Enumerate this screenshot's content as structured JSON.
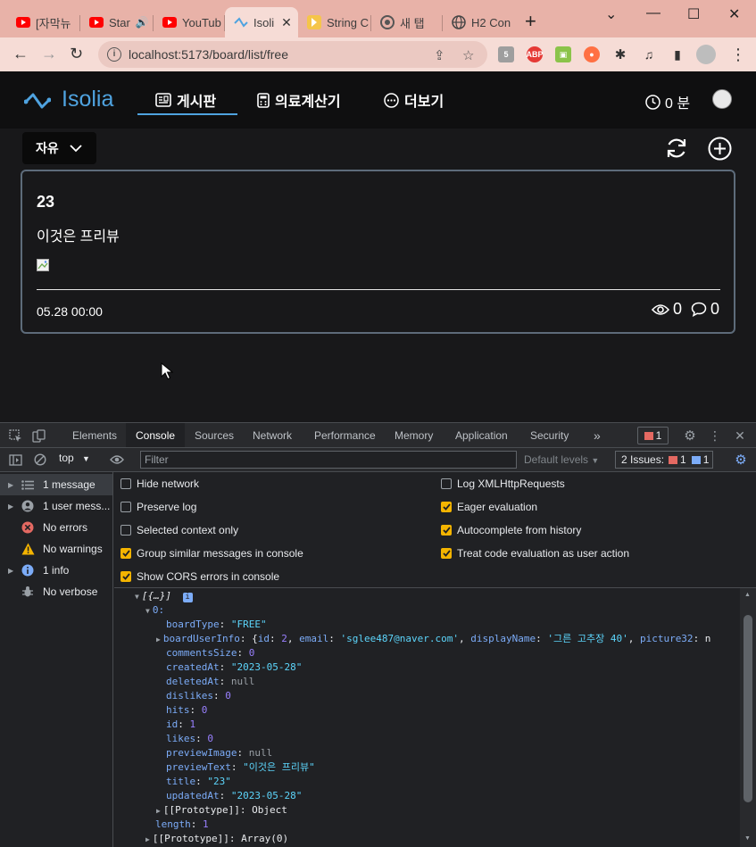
{
  "browser": {
    "tabs": [
      {
        "title": "[자막뉴",
        "icon": "youtube-icon"
      },
      {
        "title": "Star",
        "icon": "youtube-icon",
        "audio": true
      },
      {
        "title": "YouTub",
        "icon": "youtube-icon"
      },
      {
        "title": "Isoli",
        "icon": "isolia-icon",
        "active": true
      },
      {
        "title": "String C",
        "icon": "string-icon"
      },
      {
        "title": "새 탭",
        "icon": "chrome-icon"
      },
      {
        "title": "H2 Con",
        "icon": "globe-icon"
      }
    ],
    "url": "localhost:5173/board/list/free",
    "colors": {
      "tabstrip": "#e8b2a8",
      "toolbar": "#f6dcd6"
    }
  },
  "app": {
    "brand": "Isolia",
    "nav": [
      {
        "label": "게시판",
        "icon": "board-icon"
      },
      {
        "label": "의료계산기",
        "icon": "calculator-icon"
      },
      {
        "label": "더보기",
        "icon": "more-icon"
      }
    ],
    "timer": "0 분",
    "board_select": "자유",
    "post": {
      "title": "23",
      "preview": "이것은 프리뷰",
      "date": "05.28 00:00",
      "views": "0",
      "comments": "0"
    },
    "colors": {
      "accent": "#4fa3e0",
      "background": "#18181a",
      "card_border": "#5d6b7a"
    }
  },
  "devtools": {
    "tabs": [
      "Elements",
      "Console",
      "Sources",
      "Network",
      "Performance",
      "Memory",
      "Application",
      "Security"
    ],
    "active_tab": "Console",
    "more": "»",
    "error_count": "1",
    "context": "top",
    "filter_placeholder": "Filter",
    "levels": "Default levels",
    "issues_label": "2 Issues:",
    "issues_errors": "1",
    "issues_info": "1",
    "sidebar": [
      {
        "label": "1 message",
        "icon": "list-icon",
        "expandable": true
      },
      {
        "label": "1 user mess...",
        "icon": "user-icon",
        "expandable": true
      },
      {
        "label": "No errors",
        "icon": "error-icon"
      },
      {
        "label": "No warnings",
        "icon": "warning-icon"
      },
      {
        "label": "1 info",
        "icon": "info-icon",
        "expandable": true
      },
      {
        "label": "No verbose",
        "icon": "bug-icon"
      }
    ],
    "settings_left": [
      {
        "label": "Hide network",
        "checked": false
      },
      {
        "label": "Preserve log",
        "checked": false
      },
      {
        "label": "Selected context only",
        "checked": false
      },
      {
        "label": "Group similar messages in console",
        "checked": true
      },
      {
        "label": "Show CORS errors in console",
        "checked": true
      }
    ],
    "settings_right": [
      {
        "label": "Log XMLHttpRequests",
        "checked": false
      },
      {
        "label": "Eager evaluation",
        "checked": true
      },
      {
        "label": "Autocomplete from history",
        "checked": true
      },
      {
        "label": "Treat code evaluation as user action",
        "checked": true
      }
    ],
    "console": {
      "array_label": "[{…}]",
      "index": "0:",
      "fields": [
        {
          "key": "boardType",
          "value": "\"FREE\"",
          "kind": "s"
        },
        {
          "key": "boardUserInfo",
          "value": "{id: 2, email: 'sglee487@naver.com', displayName: '그른 고추장 40', picture32: n",
          "kind": "obj",
          "expandable": true
        },
        {
          "key": "commentsSize",
          "value": "0",
          "kind": "n"
        },
        {
          "key": "createdAt",
          "value": "\"2023-05-28\"",
          "kind": "s"
        },
        {
          "key": "deletedAt",
          "value": "null",
          "kind": "nl"
        },
        {
          "key": "dislikes",
          "value": "0",
          "kind": "n"
        },
        {
          "key": "hits",
          "value": "0",
          "kind": "n"
        },
        {
          "key": "id",
          "value": "1",
          "kind": "n"
        },
        {
          "key": "likes",
          "value": "0",
          "kind": "n"
        },
        {
          "key": "previewImage",
          "value": "null",
          "kind": "nl"
        },
        {
          "key": "previewText",
          "value": "\"이것은 프리뷰\"",
          "kind": "s"
        },
        {
          "key": "title",
          "value": "\"23\"",
          "kind": "s"
        },
        {
          "key": "updatedAt",
          "value": "\"2023-05-28\"",
          "kind": "s"
        }
      ],
      "proto_object": "[[Prototype]]: Object",
      "length_key": "length",
      "length_value": "1",
      "proto_array": "[[Prototype]]: Array(0)"
    }
  }
}
